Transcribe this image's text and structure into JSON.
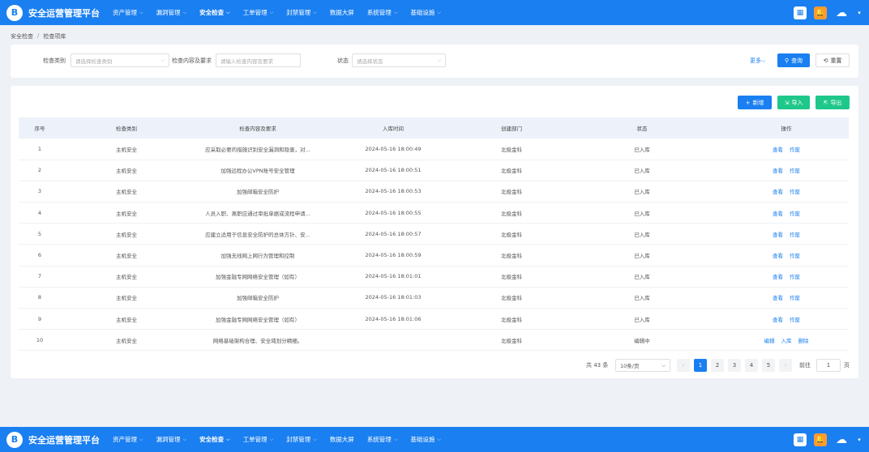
{
  "app": {
    "title": "安全运营管理平台",
    "logo_letter": "B"
  },
  "menu": [
    {
      "label": "资产管理",
      "active": false
    },
    {
      "label": "漏洞管理",
      "active": false
    },
    {
      "label": "安全检查",
      "active": true
    },
    {
      "label": "工单管理",
      "active": false
    },
    {
      "label": "封禁管理",
      "active": false
    },
    {
      "label": "数据大屏",
      "active": false,
      "no_caret": true
    },
    {
      "label": "系统管理",
      "active": false
    },
    {
      "label": "基础设施",
      "active": false
    }
  ],
  "breadcrumb": {
    "parent": "安全检查",
    "separator": "/",
    "current": "检查项库"
  },
  "filters": {
    "category_label": "检查类别",
    "category_placeholder": "请选择检查类别",
    "content_label": "检查内容及要求",
    "content_placeholder": "请输入检查内容及要求",
    "status_label": "状态",
    "status_placeholder": "请选择状态",
    "more": "更多",
    "query": "查询",
    "reset": "重置"
  },
  "actions": {
    "add": "新增",
    "import": "导入",
    "export": "导出"
  },
  "table": {
    "columns": [
      "序号",
      "检查类别",
      "检查内容及要求",
      "入库时间",
      "创建部门",
      "状态",
      "操作"
    ],
    "rows": [
      {
        "idx": "1",
        "category": "主机安全",
        "content": "应采取必要的措施识别安全漏洞和隐患，对...",
        "time": "2024-05-16 18:00:49",
        "dept": "北极金科",
        "status": "已入库",
        "ops": [
          "查看",
          "作废"
        ]
      },
      {
        "idx": "2",
        "category": "主机安全",
        "content": "加强远程办公VPN账号安全管理",
        "time": "2024-05-16 18:00:51",
        "dept": "北极金科",
        "status": "已入库",
        "ops": [
          "查看",
          "作废"
        ]
      },
      {
        "idx": "3",
        "category": "主机安全",
        "content": "加强邮箱安全防护",
        "time": "2024-05-16 18:00:53",
        "dept": "北极金科",
        "status": "已入库",
        "ops": [
          "查看",
          "作废"
        ]
      },
      {
        "idx": "4",
        "category": "主机安全",
        "content": "人员入职、离职应通过审批单据或流程申请...",
        "time": "2024-05-16 18:00:55",
        "dept": "北极金科",
        "status": "已入库",
        "ops": [
          "查看",
          "作废"
        ]
      },
      {
        "idx": "5",
        "category": "主机安全",
        "content": "应建立适用于信息安全防护的总体方针、安...",
        "time": "2024-05-16 18:00:57",
        "dept": "北极金科",
        "status": "已入库",
        "ops": [
          "查看",
          "作废"
        ]
      },
      {
        "idx": "6",
        "category": "主机安全",
        "content": "加强无线网上网行为管理和控制",
        "time": "2024-05-16 18:00:59",
        "dept": "北极金科",
        "status": "已入库",
        "ops": [
          "查看",
          "作废"
        ]
      },
      {
        "idx": "7",
        "category": "主机安全",
        "content": "加强金融专网网络安全管理（如有）",
        "time": "2024-05-16 18:01:01",
        "dept": "北极金科",
        "status": "已入库",
        "ops": [
          "查看",
          "作废"
        ]
      },
      {
        "idx": "8",
        "category": "主机安全",
        "content": "加强邮箱安全防护",
        "time": "2024-05-16 18:01:03",
        "dept": "北极金科",
        "status": "已入库",
        "ops": [
          "查看",
          "作废"
        ]
      },
      {
        "idx": "9",
        "category": "主机安全",
        "content": "加强金融专网网络安全管理（如有）",
        "time": "2024-05-16 18:01:06",
        "dept": "北极金科",
        "status": "已入库",
        "ops": [
          "查看",
          "作废"
        ]
      },
      {
        "idx": "10",
        "category": "主机安全",
        "content": "网络基础架构合理、安全域划分精细。",
        "time": "",
        "dept": "北极金科",
        "status": "编辑中",
        "ops": [
          "编辑",
          "入库",
          "删除"
        ]
      }
    ]
  },
  "pagination": {
    "total": "共 43 条",
    "page_size": "10条/页",
    "pages": [
      "1",
      "2",
      "3",
      "4",
      "5"
    ],
    "current": "1",
    "goto_prefix": "前往",
    "goto_value": "1",
    "goto_suffix": "页"
  }
}
